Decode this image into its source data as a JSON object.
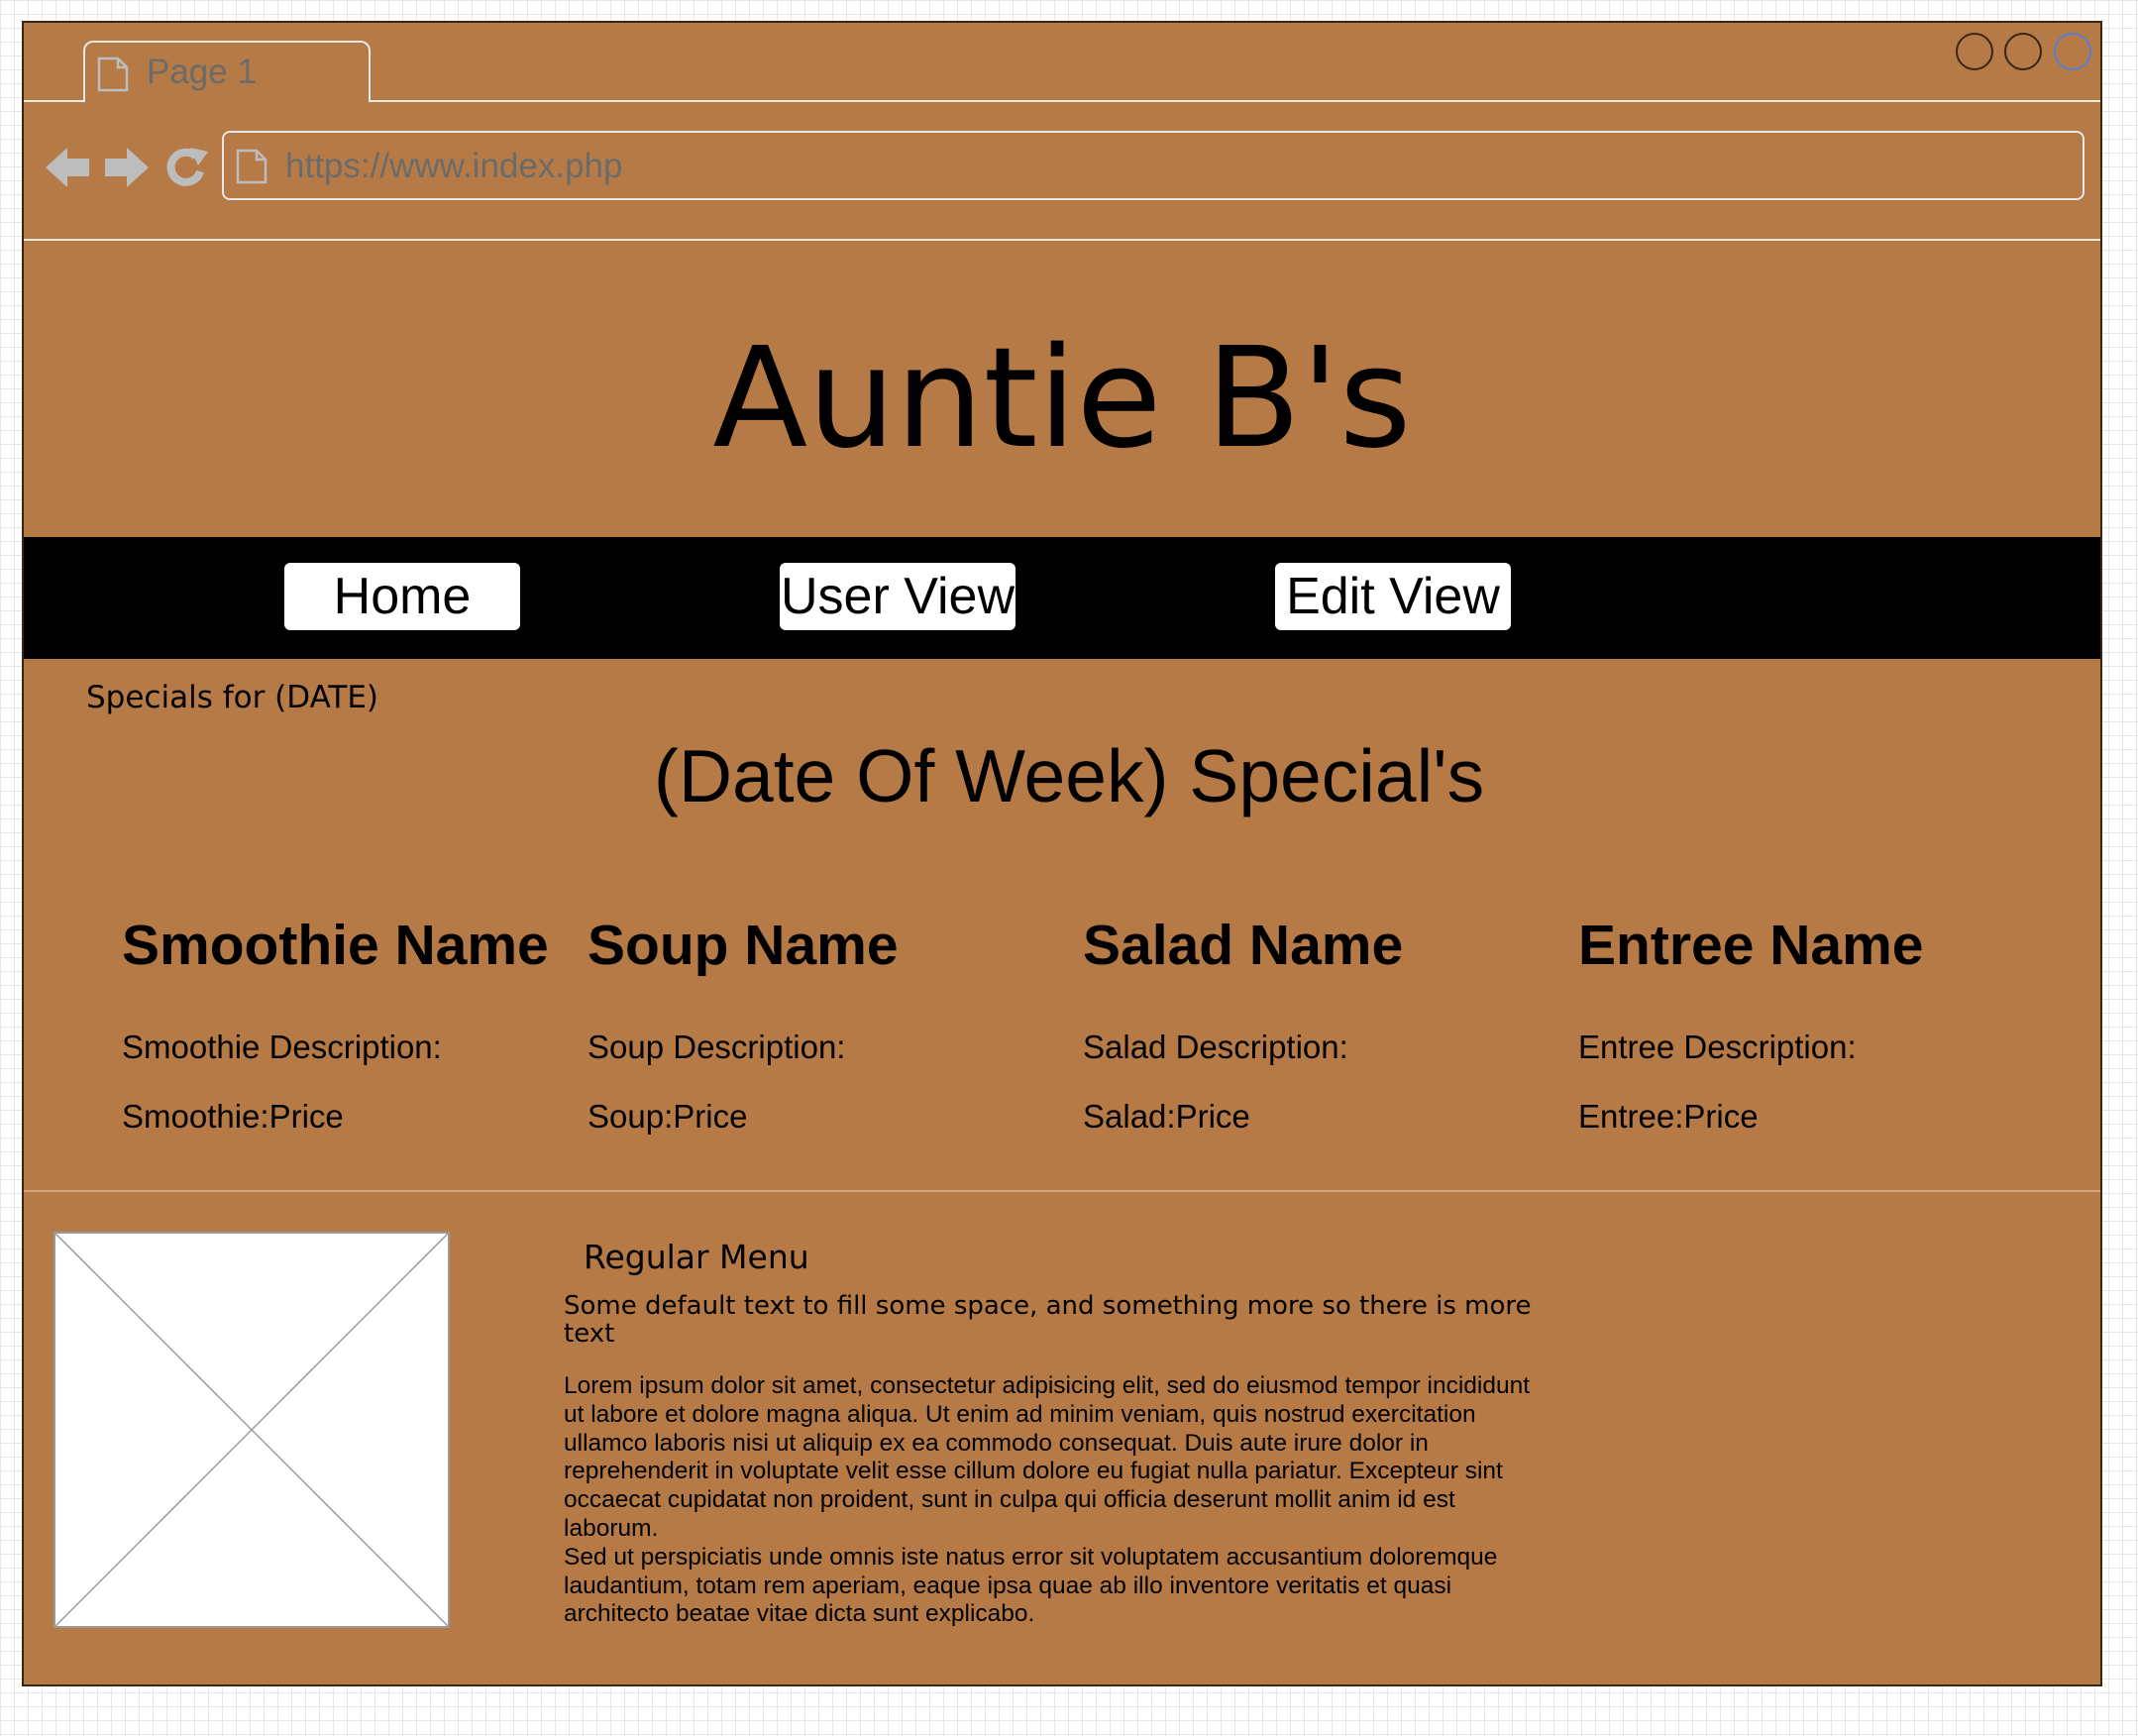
{
  "browser": {
    "tab_label": "Page 1",
    "url": "https://www.index.php"
  },
  "site": {
    "title": "Auntie B's"
  },
  "nav": {
    "items": [
      {
        "label": "Home"
      },
      {
        "label": "User View"
      },
      {
        "label": "Edit View"
      }
    ]
  },
  "specials": {
    "date_label": "Specials for (DATE)",
    "week_title": "(Date Of Week) Special's",
    "columns": [
      {
        "name": "Smoothie Name",
        "description": "Smoothie Description:",
        "price": "Smoothie:Price"
      },
      {
        "name": "Soup Name",
        "description": "Soup Description:",
        "price": "Soup:Price"
      },
      {
        "name": "Salad Name",
        "description": "Salad Description:",
        "price": "Salad:Price"
      },
      {
        "name": "Entree Name",
        "description": "Entree Description:",
        "price": "Entree:Price"
      }
    ]
  },
  "regular_menu": {
    "title": "Regular Menu",
    "intro": "Some default text to fill some space, and something more so there is more text",
    "body": "Lorem ipsum dolor sit amet, consectetur adipisicing elit, sed do eiusmod tempor incididunt ut labore et dolore magna aliqua. Ut enim ad minim veniam, quis nostrud exercitation ullamco laboris nisi ut aliquip ex ea commodo consequat. Duis aute irure dolor in reprehenderit in voluptate velit esse cillum dolore eu fugiat nulla pariatur. Excepteur sint occaecat cupidatat non proident, sunt in culpa qui officia deserunt mollit anim id est laborum.\nSed ut perspiciatis unde omnis iste natus error sit voluptatem accusantium doloremque laudantium, totam rem aperiam, eaque ipsa quae ab illo inventore veritatis et quasi architecto beatae vitae dicta sunt explicabo."
  },
  "colors": {
    "page_background": "#b57a45",
    "nav_background": "#000000",
    "button_background": "#ffffff",
    "chrome_lines": "#e8e8e8"
  }
}
